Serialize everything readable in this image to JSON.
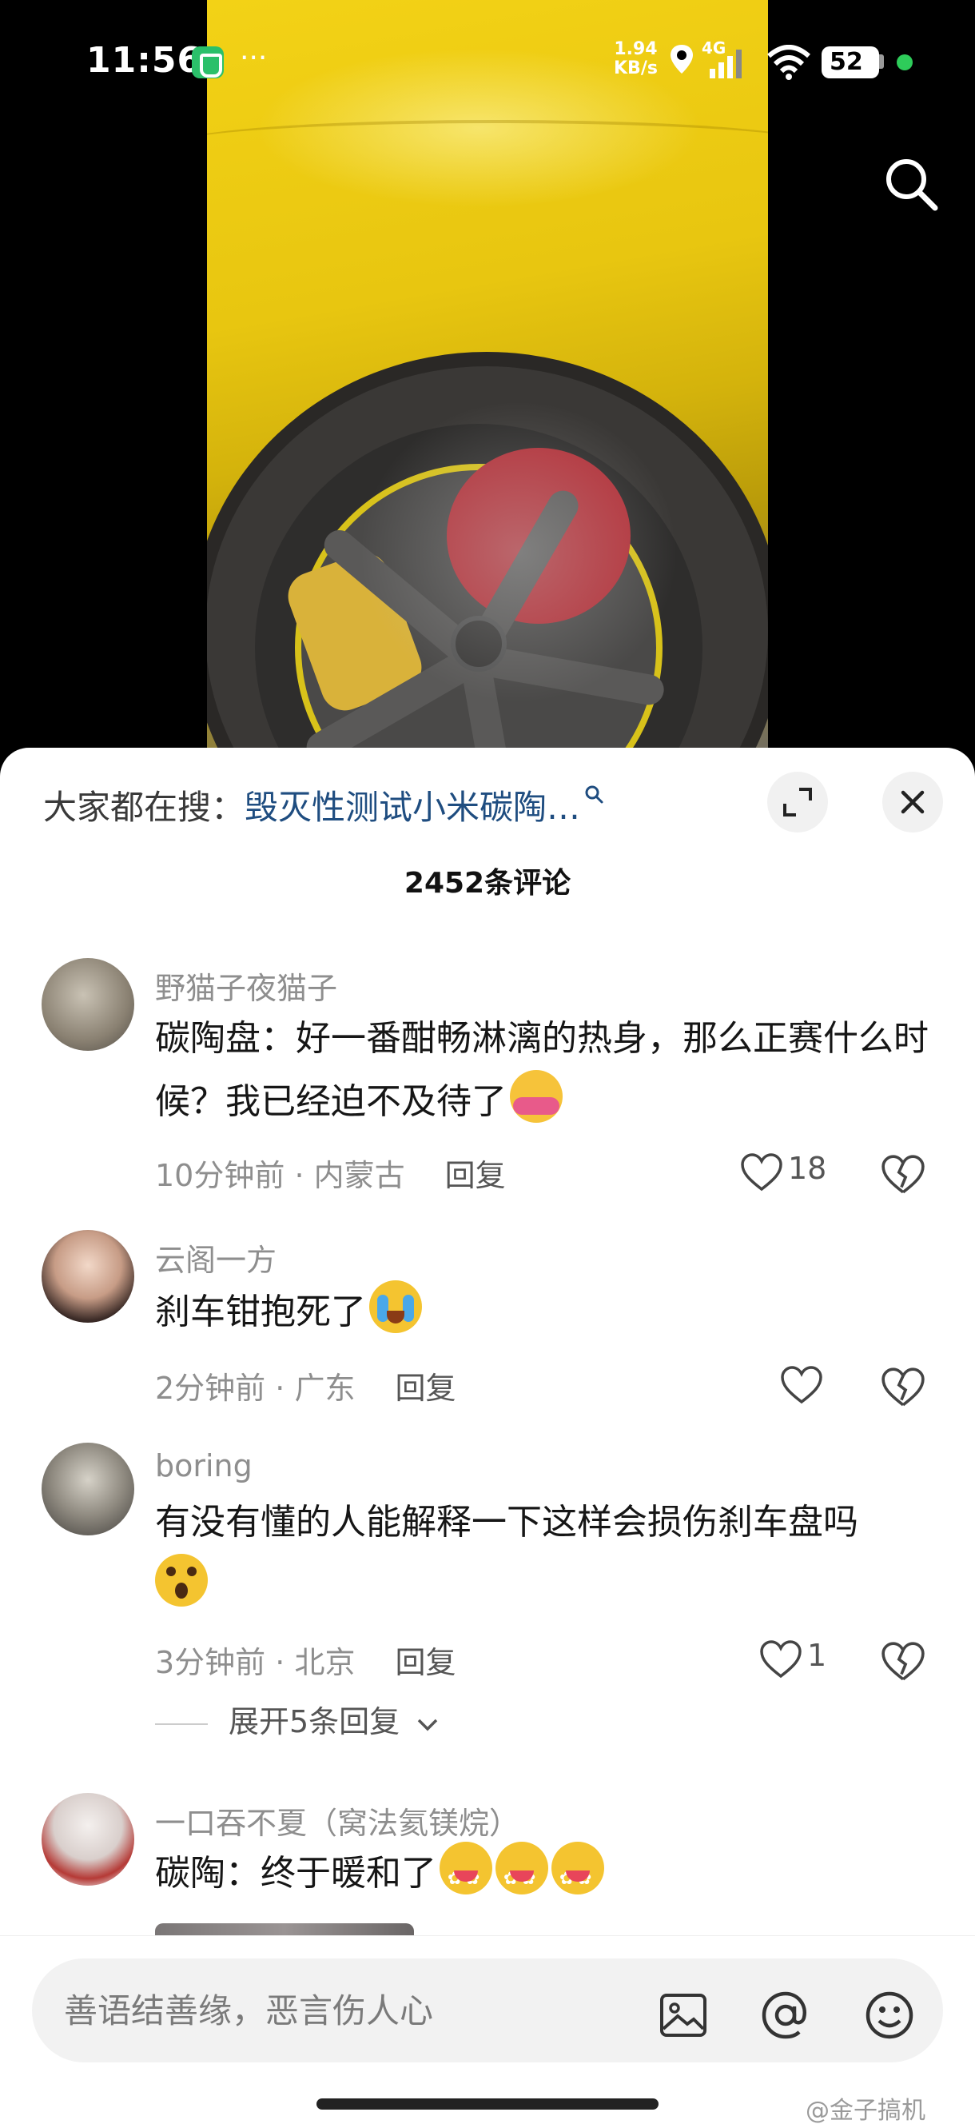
{
  "status_bar": {
    "time": "11:56",
    "dots": "···",
    "net_speed_value": "1.94",
    "net_speed_unit": "KB/s",
    "net_type": "4G",
    "battery": "52"
  },
  "comments_panel": {
    "hot_search_prefix": "大家都在搜：",
    "hot_search_query": "毁灭性测试小米碳陶…",
    "comment_count": "2452条评论"
  },
  "comments": [
    {
      "username": "野猫子夜猫子",
      "text": "碳陶盘：好一番酣畅淋漓的热身，那么正赛什么时候？我已经迫不及待了",
      "time": "10分钟前",
      "location": "内蒙古",
      "reply_label": "回复",
      "likes": "18"
    },
    {
      "username": "云阁一方",
      "text": "刹车钳抱死了",
      "time": "2分钟前",
      "location": "广东",
      "reply_label": "回复",
      "likes": ""
    },
    {
      "username": "boring",
      "text": "有没有懂的人能解释一下这样会损伤刹车盘吗",
      "time": "3分钟前",
      "location": "北京",
      "reply_label": "回复",
      "likes": "1"
    },
    {
      "username": "一口吞不夏（窝法氦镁烷）",
      "text": "碳陶：终于暖和了",
      "time": "",
      "location": "",
      "reply_label": "",
      "likes": ""
    }
  ],
  "expand_replies": "展开5条回复",
  "input_bar": {
    "placeholder": "善语结善缘，恶言伤人心"
  },
  "watermark": "@金子搞机",
  "icons": {
    "search": "search-icon",
    "expand": "expand-icon",
    "close": "close-icon",
    "like": "heart-icon",
    "dislike": "broken-heart-icon",
    "image": "image-icon",
    "mention": "at-icon",
    "emoji": "emoji-icon"
  },
  "colors": {
    "link_blue": "#1f4d80",
    "meta_gray": "#8e8e8e",
    "car_yellow": "#f3d216"
  }
}
